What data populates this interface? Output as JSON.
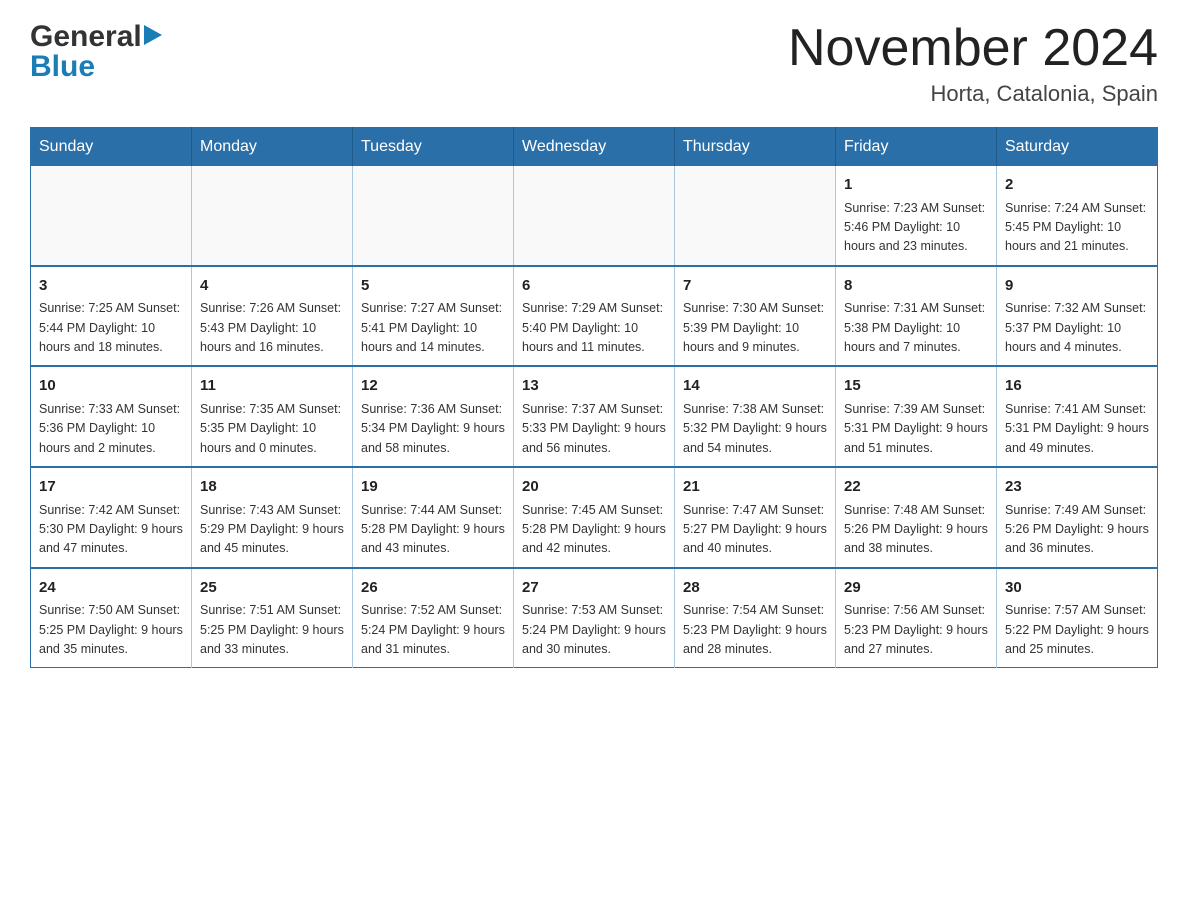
{
  "header": {
    "logo_general": "General",
    "logo_blue": "Blue",
    "month_title": "November 2024",
    "location": "Horta, Catalonia, Spain"
  },
  "calendar": {
    "days_of_week": [
      "Sunday",
      "Monday",
      "Tuesday",
      "Wednesday",
      "Thursday",
      "Friday",
      "Saturday"
    ],
    "weeks": [
      [
        {
          "day": "",
          "info": ""
        },
        {
          "day": "",
          "info": ""
        },
        {
          "day": "",
          "info": ""
        },
        {
          "day": "",
          "info": ""
        },
        {
          "day": "",
          "info": ""
        },
        {
          "day": "1",
          "info": "Sunrise: 7:23 AM\nSunset: 5:46 PM\nDaylight: 10 hours and 23 minutes."
        },
        {
          "day": "2",
          "info": "Sunrise: 7:24 AM\nSunset: 5:45 PM\nDaylight: 10 hours and 21 minutes."
        }
      ],
      [
        {
          "day": "3",
          "info": "Sunrise: 7:25 AM\nSunset: 5:44 PM\nDaylight: 10 hours and 18 minutes."
        },
        {
          "day": "4",
          "info": "Sunrise: 7:26 AM\nSunset: 5:43 PM\nDaylight: 10 hours and 16 minutes."
        },
        {
          "day": "5",
          "info": "Sunrise: 7:27 AM\nSunset: 5:41 PM\nDaylight: 10 hours and 14 minutes."
        },
        {
          "day": "6",
          "info": "Sunrise: 7:29 AM\nSunset: 5:40 PM\nDaylight: 10 hours and 11 minutes."
        },
        {
          "day": "7",
          "info": "Sunrise: 7:30 AM\nSunset: 5:39 PM\nDaylight: 10 hours and 9 minutes."
        },
        {
          "day": "8",
          "info": "Sunrise: 7:31 AM\nSunset: 5:38 PM\nDaylight: 10 hours and 7 minutes."
        },
        {
          "day": "9",
          "info": "Sunrise: 7:32 AM\nSunset: 5:37 PM\nDaylight: 10 hours and 4 minutes."
        }
      ],
      [
        {
          "day": "10",
          "info": "Sunrise: 7:33 AM\nSunset: 5:36 PM\nDaylight: 10 hours and 2 minutes."
        },
        {
          "day": "11",
          "info": "Sunrise: 7:35 AM\nSunset: 5:35 PM\nDaylight: 10 hours and 0 minutes."
        },
        {
          "day": "12",
          "info": "Sunrise: 7:36 AM\nSunset: 5:34 PM\nDaylight: 9 hours and 58 minutes."
        },
        {
          "day": "13",
          "info": "Sunrise: 7:37 AM\nSunset: 5:33 PM\nDaylight: 9 hours and 56 minutes."
        },
        {
          "day": "14",
          "info": "Sunrise: 7:38 AM\nSunset: 5:32 PM\nDaylight: 9 hours and 54 minutes."
        },
        {
          "day": "15",
          "info": "Sunrise: 7:39 AM\nSunset: 5:31 PM\nDaylight: 9 hours and 51 minutes."
        },
        {
          "day": "16",
          "info": "Sunrise: 7:41 AM\nSunset: 5:31 PM\nDaylight: 9 hours and 49 minutes."
        }
      ],
      [
        {
          "day": "17",
          "info": "Sunrise: 7:42 AM\nSunset: 5:30 PM\nDaylight: 9 hours and 47 minutes."
        },
        {
          "day": "18",
          "info": "Sunrise: 7:43 AM\nSunset: 5:29 PM\nDaylight: 9 hours and 45 minutes."
        },
        {
          "day": "19",
          "info": "Sunrise: 7:44 AM\nSunset: 5:28 PM\nDaylight: 9 hours and 43 minutes."
        },
        {
          "day": "20",
          "info": "Sunrise: 7:45 AM\nSunset: 5:28 PM\nDaylight: 9 hours and 42 minutes."
        },
        {
          "day": "21",
          "info": "Sunrise: 7:47 AM\nSunset: 5:27 PM\nDaylight: 9 hours and 40 minutes."
        },
        {
          "day": "22",
          "info": "Sunrise: 7:48 AM\nSunset: 5:26 PM\nDaylight: 9 hours and 38 minutes."
        },
        {
          "day": "23",
          "info": "Sunrise: 7:49 AM\nSunset: 5:26 PM\nDaylight: 9 hours and 36 minutes."
        }
      ],
      [
        {
          "day": "24",
          "info": "Sunrise: 7:50 AM\nSunset: 5:25 PM\nDaylight: 9 hours and 35 minutes."
        },
        {
          "day": "25",
          "info": "Sunrise: 7:51 AM\nSunset: 5:25 PM\nDaylight: 9 hours and 33 minutes."
        },
        {
          "day": "26",
          "info": "Sunrise: 7:52 AM\nSunset: 5:24 PM\nDaylight: 9 hours and 31 minutes."
        },
        {
          "day": "27",
          "info": "Sunrise: 7:53 AM\nSunset: 5:24 PM\nDaylight: 9 hours and 30 minutes."
        },
        {
          "day": "28",
          "info": "Sunrise: 7:54 AM\nSunset: 5:23 PM\nDaylight: 9 hours and 28 minutes."
        },
        {
          "day": "29",
          "info": "Sunrise: 7:56 AM\nSunset: 5:23 PM\nDaylight: 9 hours and 27 minutes."
        },
        {
          "day": "30",
          "info": "Sunrise: 7:57 AM\nSunset: 5:22 PM\nDaylight: 9 hours and 25 minutes."
        }
      ]
    ]
  }
}
